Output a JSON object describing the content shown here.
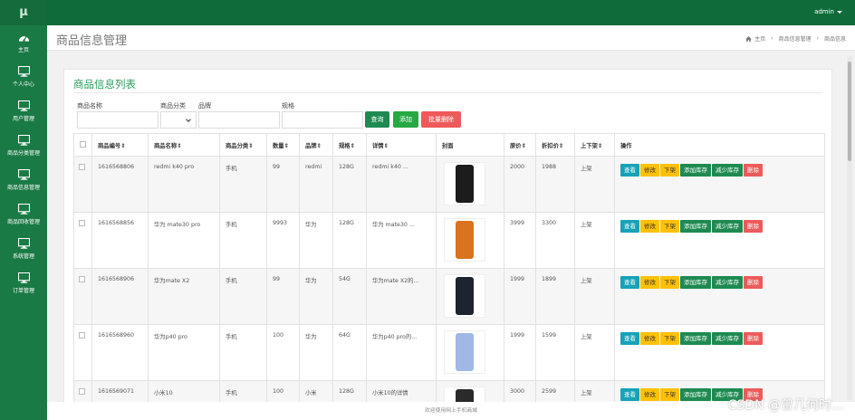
{
  "app": {
    "logo": "μ",
    "user": "admin"
  },
  "sidebar": {
    "items": [
      {
        "label": "主页",
        "icon": "dashboard-icon"
      },
      {
        "label": "个人中心",
        "icon": "monitor-icon"
      },
      {
        "label": "用户管理",
        "icon": "monitor-icon"
      },
      {
        "label": "商品分类管理",
        "icon": "monitor-icon"
      },
      {
        "label": "商品信息管理",
        "icon": "monitor-icon"
      },
      {
        "label": "商品回收管理",
        "icon": "monitor-icon"
      },
      {
        "label": "系统管理",
        "icon": "monitor-icon"
      },
      {
        "label": "订单管理",
        "icon": "monitor-icon"
      }
    ]
  },
  "header": {
    "title": "商品信息管理",
    "breadcrumb": [
      "主页",
      "商品信息管理",
      "商品信息"
    ]
  },
  "card": {
    "title": "商品信息列表"
  },
  "filters": {
    "name_label": "商品名称",
    "category_label": "商品分类",
    "brand_label": "品牌",
    "spec_label": "规格",
    "query_button": "查询",
    "add_button": "添加",
    "batch_delete_button": "批量删除"
  },
  "table": {
    "headers": [
      "商品编号⇕",
      "商品名称⇕",
      "商品分类⇕",
      "数量⇕",
      "品牌⇕",
      "规格⇕",
      "详情⇕",
      "封面",
      "原价⇕",
      "折扣价⇕",
      "上下架⇕",
      "操作"
    ],
    "rows": [
      {
        "id": "1616568806",
        "name": "redmi k40 pro",
        "category": "手机",
        "qty": "99",
        "brand": "redmi",
        "spec": "128G",
        "detail": "redmi k40 ...",
        "price": "2000",
        "discount": "1988",
        "status": "上架",
        "phone_color": "#1c1c1c"
      },
      {
        "id": "1616568856",
        "name": "华为 mate30 pro",
        "category": "手机",
        "qty": "9993",
        "brand": "华为",
        "spec": "128G",
        "detail": "华为 mate30 ...",
        "price": "3999",
        "discount": "3300",
        "status": "上架",
        "phone_color": "#d9731f"
      },
      {
        "id": "1616568906",
        "name": "华为mate X2",
        "category": "手机",
        "qty": "99",
        "brand": "华为",
        "spec": "54G",
        "detail": "华为mate X2的...",
        "price": "1999",
        "discount": "1899",
        "status": "上架",
        "phone_color": "#1d2430"
      },
      {
        "id": "1616568960",
        "name": "华为p40 pro",
        "category": "手机",
        "qty": "100",
        "brand": "华为",
        "spec": "64G",
        "detail": "华为p40 pro的...",
        "price": "1999",
        "discount": "1599",
        "status": "上架",
        "phone_color": "#9fb8e6"
      },
      {
        "id": "1616569071",
        "name": "小米10",
        "category": "手机",
        "qty": "100",
        "brand": "小米",
        "spec": "128G",
        "detail": "小米10的详情",
        "price": "3000",
        "discount": "2599",
        "status": "上架",
        "phone_color": "#2a2a2a"
      }
    ],
    "ops": [
      "查看",
      "修改",
      "下架",
      "添加库存",
      "减少库存",
      "删除"
    ]
  },
  "footer": {
    "text": "欢迎使用网上手机商城"
  },
  "watermark": "CSDN @曾几何时…",
  "colors": {
    "sidebar": "#1a7a45",
    "topbar": "#0f6b39",
    "accent": "#2a9d59",
    "danger": "#ee5a5a",
    "info": "#17a2b8",
    "warning": "#ffc107"
  }
}
